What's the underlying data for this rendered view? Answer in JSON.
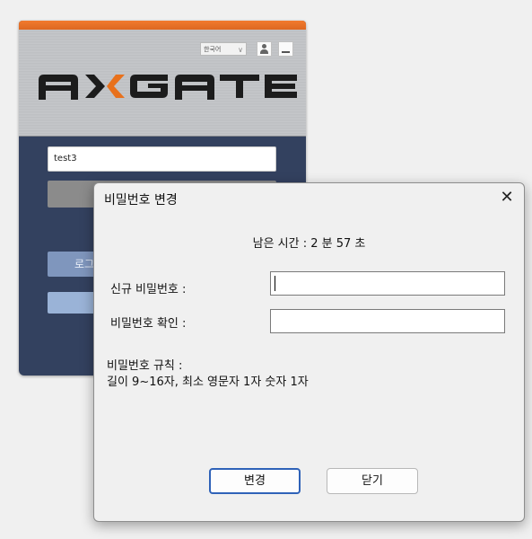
{
  "login_window": {
    "language": "한국어",
    "username_value": "test3",
    "login_button_label": "로그",
    "brand": "AXGATE",
    "colors": {
      "panel": "#33415f",
      "accent": "#f27a2e",
      "button": "#7f96bd"
    }
  },
  "dialog": {
    "title": "비밀번호 변경",
    "close_icon": "close-icon",
    "remaining_time": "남은 시간 : 2 분 57 초",
    "new_password_label": "신규 비밀번호 :",
    "new_password_value": "",
    "confirm_password_label": "비밀번호 확인 :",
    "confirm_password_value": "",
    "rules_title": "비밀번호 규칙 :",
    "rules_text": "길이 9~16자, 최소 영문자 1자 숫자 1자",
    "change_button": "변경",
    "close_button": "닫기",
    "colors": {
      "primary_border": "#2f62b8"
    }
  }
}
